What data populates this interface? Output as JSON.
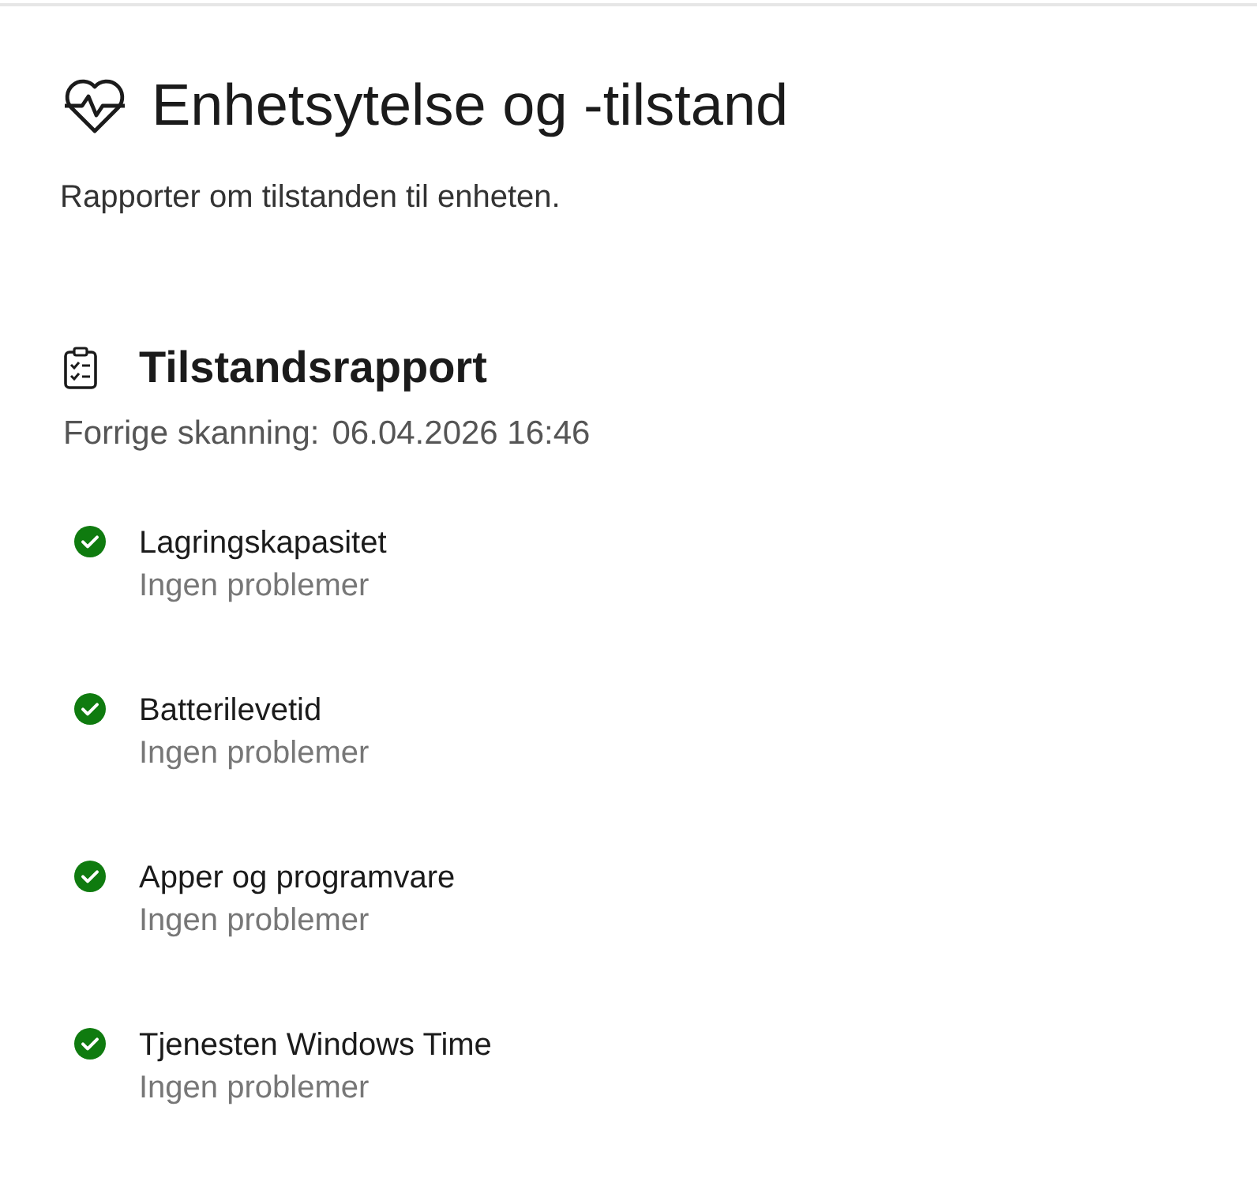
{
  "page": {
    "title": "Enhetsytelse og -tilstand",
    "description": "Rapporter om tilstanden til enheten."
  },
  "report": {
    "heading": "Tilstandsrapport",
    "last_scan_label": "Forrige skanning:",
    "last_scan_time": "06.04.2026 16:46",
    "items": [
      {
        "name": "Lagringskapasitet",
        "healthy": true,
        "detail": "Ingen problemer"
      },
      {
        "name": "Batterilevetid",
        "healthy": true,
        "detail": "Ingen problemer"
      },
      {
        "name": "Apper og programvare",
        "healthy": true,
        "detail": "Ingen problemer"
      },
      {
        "name": "Tjenesten Windows Time",
        "healthy": true,
        "detail": "Ingen problemer"
      }
    ]
  }
}
